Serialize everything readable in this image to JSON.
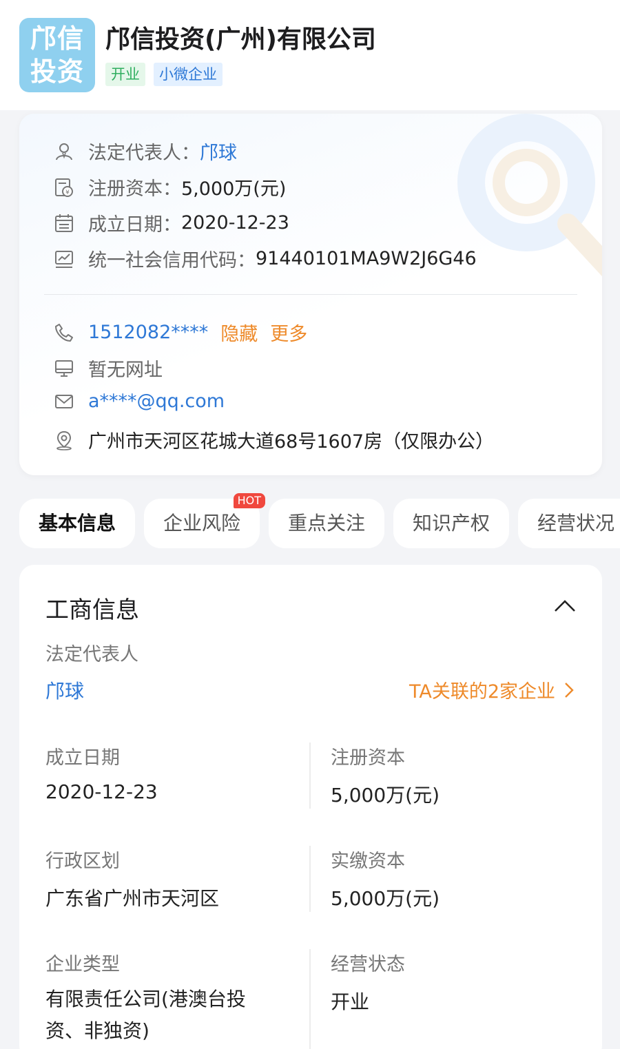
{
  "company": {
    "logo_line1": "邝信",
    "logo_line2": "投资",
    "name": "邝信投资(广州)有限公司",
    "tags": [
      "开业",
      "小微企业"
    ]
  },
  "info": {
    "legal_rep_label": "法定代表人：",
    "legal_rep_value": "邝球",
    "capital_label": "注册资本：",
    "capital_value": "5,000万(元)",
    "founded_label": "成立日期：",
    "founded_value": "2020-12-23",
    "credit_code_label": "统一社会信用代码：",
    "credit_code_value": "91440101MA9W2J6G46",
    "phone": "1512082****",
    "phone_hide": "隐藏",
    "phone_more": "更多",
    "website": "暂无网址",
    "email": "a****@qq.com",
    "address": "广州市天河区花城大道68号1607房（仅限办公）"
  },
  "tabs": [
    {
      "label": "基本信息",
      "active": true
    },
    {
      "label": "企业风险",
      "badge": "HOT"
    },
    {
      "label": "重点关注"
    },
    {
      "label": "知识产权"
    },
    {
      "label": "经营状况"
    }
  ],
  "business": {
    "title": "工商信息",
    "legal_rep_label": "法定代表人",
    "legal_rep_value": "邝球",
    "related_text": "TA关联的2家企业",
    "founded_label": "成立日期",
    "founded_value": "2020-12-23",
    "reg_capital_label": "注册资本",
    "reg_capital_value": "5,000万(元)",
    "region_label": "行政区划",
    "region_value": "广东省广州市天河区",
    "paid_capital_label": "实缴资本",
    "paid_capital_value": "5,000万(元)",
    "type_label": "企业类型",
    "type_value": "有限责任公司(港澳台投资、非独资)",
    "status_label": "经营状态",
    "status_value": "开业"
  },
  "colors": {
    "accent_blue": "#2e78d6",
    "accent_orange": "#ee8a2a",
    "tag_green": "#2fae5f",
    "hot_red": "#f0483e",
    "logo_bg": "#8fd0ef"
  }
}
